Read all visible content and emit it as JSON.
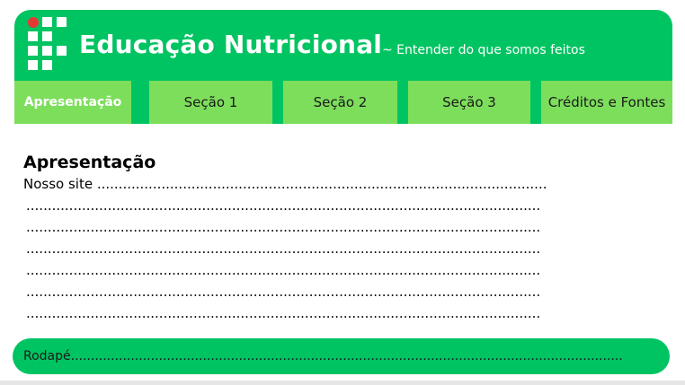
{
  "header": {
    "title": "Educação Nutricional",
    "subtitle": "~ Entender do que somos feitos",
    "logo_icon": "grid-logo-icon",
    "colors": {
      "header_bg": "#00c462",
      "nav_bg": "#7dde5c",
      "logo_dot": "#e53935"
    }
  },
  "nav": {
    "items": [
      {
        "label": "Apresentação"
      },
      {
        "label": "Seção 1"
      },
      {
        "label": "Seção 2"
      },
      {
        "label": "Seção 3"
      },
      {
        "label": "Créditos e Fontes"
      }
    ]
  },
  "main": {
    "heading": "Apresentação",
    "first_line": "Nosso site .........................................................................................................",
    "lines": [
      "........................................................................................................................",
      "........................................................................................................................",
      "........................................................................................................................",
      "........................................................................................................................",
      "........................................................................................................................",
      "........................................................................................................................"
    ]
  },
  "footer": {
    "text": "Rodapé.........................................................................................................................................."
  }
}
